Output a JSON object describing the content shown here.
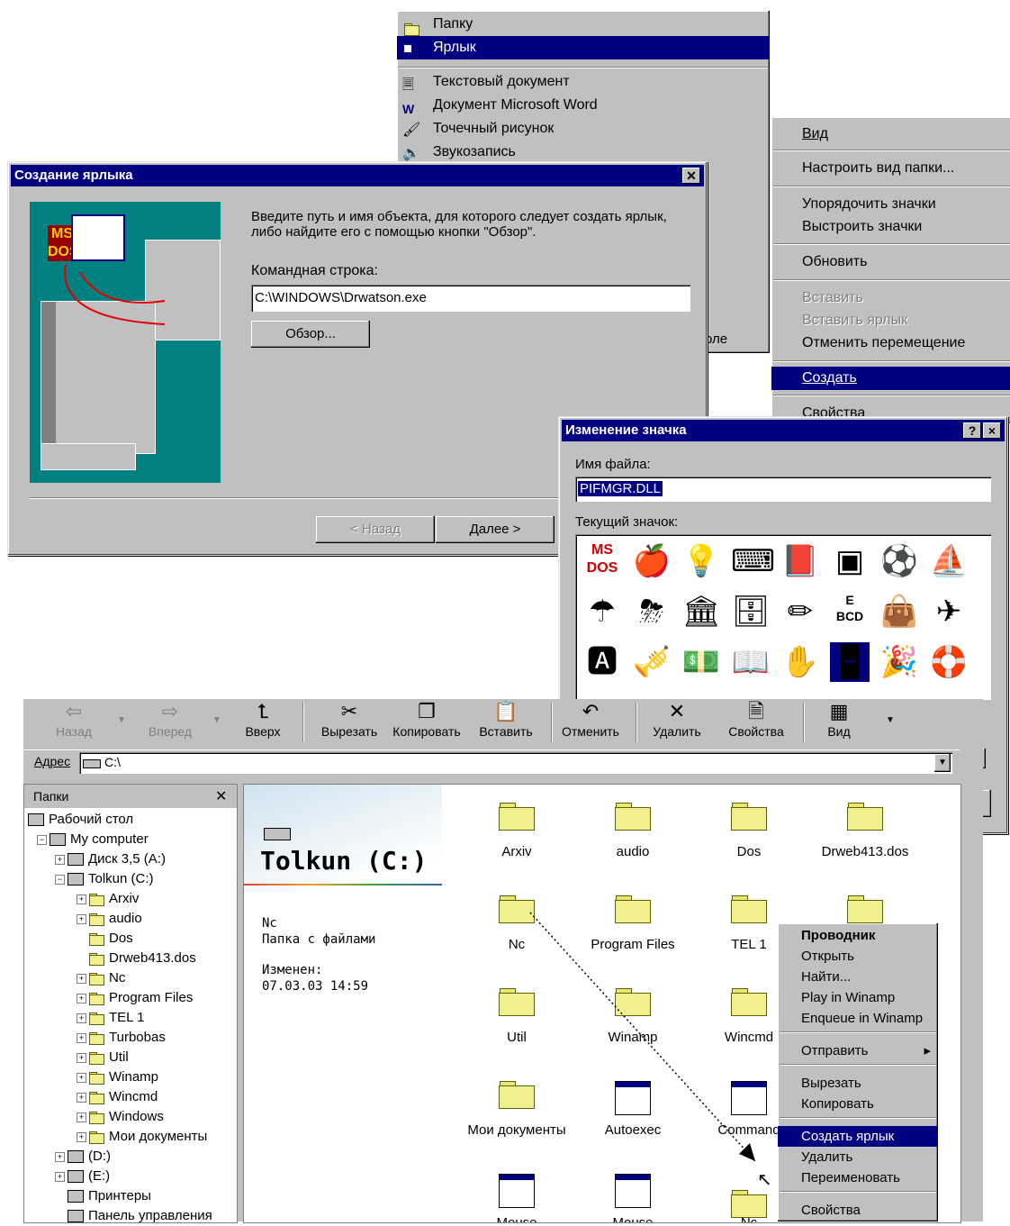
{
  "new_submenu": {
    "items": [
      {
        "label": "Папку",
        "icon": "folder-icon"
      },
      {
        "label": "Ярлык",
        "icon": "shortcut-icon",
        "selected": true
      },
      {
        "label": "Текстовый документ",
        "icon": "text-document-icon"
      },
      {
        "label": "Документ Microsoft Word",
        "icon": "word-document-icon"
      },
      {
        "label": "Точечный рисунок",
        "icon": "bitmap-icon"
      },
      {
        "label": "Звукозапись",
        "icon": "sound-icon"
      }
    ],
    "partial_text": "оле"
  },
  "desktop_menu": {
    "items": [
      {
        "label": "Вид",
        "submenu": true
      },
      {
        "label": "Настроить вид папки..."
      },
      {
        "label": "Упорядочить значки",
        "submenu": true
      },
      {
        "label": "Выстроить значки"
      },
      {
        "label": "Обновить"
      },
      {
        "label": "Вставить",
        "disabled": true
      },
      {
        "label": "Вставить ярлык",
        "disabled": true
      },
      {
        "label": "Отменить перемещение"
      },
      {
        "label": "Создать",
        "selected": true,
        "submenu": true
      },
      {
        "label": "Свойства"
      }
    ]
  },
  "create_shortcut_dialog": {
    "title": "Создание ярлыка",
    "instructions": "Введите путь и имя объекта, для которого следует создать ярлык, либо найдите его с помощью кнопки \"Обзор\".",
    "command_line_label": "Командная строка:",
    "command_line_value": "C:\\WINDOWS\\Drwatson.exe",
    "browse_label": "Обзор...",
    "back_label": "< Назад",
    "next_label": "Далее >"
  },
  "change_icon_dialog": {
    "title": "Изменение значка",
    "help_label": "?",
    "close_label": "×",
    "filename_label": "Имя файла:",
    "filename_value": "PIFMGR.DLL",
    "current_icon_label": "Текущий значок:",
    "icons": [
      "ms-dos-icon",
      "apple-icon",
      "lightbulb-icon",
      "keyboard-icon",
      "book-icon",
      "window-icon",
      "soccer-ball-icon",
      "ship-icon",
      "umbrella-icon",
      "storm-cloud-icon",
      "column-icon",
      "cabinet-icon",
      "pencil-icon",
      "eye-chart-icon",
      "bag-icon",
      "airplane-icon",
      "blocks-icon",
      "tuba-icon",
      "money-icon",
      "open-book-icon",
      "hand-icon",
      "dominoes-icon",
      "party-hat-icon",
      "lifebuoy-icon"
    ]
  },
  "explorer": {
    "toolbar": [
      {
        "label": "Назад",
        "glyph": "⇦",
        "disabled": true
      },
      {
        "label": "Вперед",
        "glyph": "⇨",
        "disabled": true
      },
      {
        "label": "Вверх",
        "glyph": "⮤"
      },
      {
        "label": "Вырезать",
        "glyph": "✂"
      },
      {
        "label": "Копировать",
        "glyph": "❐"
      },
      {
        "label": "Вставить",
        "glyph": "📋"
      },
      {
        "label": "Отменить",
        "glyph": "↶"
      },
      {
        "label": "Удалить",
        "glyph": "✕"
      },
      {
        "label": "Свойства",
        "glyph": "🗎"
      },
      {
        "label": "Вид",
        "glyph": "▦"
      }
    ],
    "address_label": "Адрес",
    "address_value": "C:\\",
    "folders_pane_title": "Папки",
    "tree": [
      {
        "label": "Рабочий стол",
        "level": 0,
        "icon": "desktop-icon"
      },
      {
        "label": "My computer",
        "level": 1,
        "icon": "computer-icon",
        "expander": "−"
      },
      {
        "label": "Диск 3,5 (A:)",
        "level": 2,
        "icon": "floppy-icon",
        "expander": "+"
      },
      {
        "label": "Tolkun (C:)",
        "level": 2,
        "icon": "drive-icon",
        "expander": "−"
      },
      {
        "label": "Arxiv",
        "level": 3,
        "icon": "folder-icon",
        "expander": "+"
      },
      {
        "label": "audio",
        "level": 3,
        "icon": "folder-icon",
        "expander": "+"
      },
      {
        "label": "Dos",
        "level": 3,
        "icon": "folder-icon"
      },
      {
        "label": "Drweb413.dos",
        "level": 3,
        "icon": "folder-icon"
      },
      {
        "label": "Nc",
        "level": 3,
        "icon": "folder-icon",
        "expander": "+"
      },
      {
        "label": "Program Files",
        "level": 3,
        "icon": "folder-icon",
        "expander": "+"
      },
      {
        "label": "TEL 1",
        "level": 3,
        "icon": "folder-icon",
        "expander": "+"
      },
      {
        "label": "Turbobas",
        "level": 3,
        "icon": "folder-icon",
        "expander": "+"
      },
      {
        "label": "Util",
        "level": 3,
        "icon": "folder-icon",
        "expander": "+"
      },
      {
        "label": "Winamp",
        "level": 3,
        "icon": "folder-icon",
        "expander": "+"
      },
      {
        "label": "Wincmd",
        "level": 3,
        "icon": "folder-icon",
        "expander": "+"
      },
      {
        "label": "Windows",
        "level": 3,
        "icon": "folder-icon",
        "expander": "+"
      },
      {
        "label": "Мои документы",
        "level": 3,
        "icon": "my-documents-icon",
        "expander": "+"
      },
      {
        "label": "(D:)",
        "level": 2,
        "icon": "drive-icon",
        "expander": "+"
      },
      {
        "label": "(E:)",
        "level": 2,
        "icon": "cd-drive-icon",
        "expander": "+"
      },
      {
        "label": "Принтеры",
        "level": 2,
        "icon": "printer-icon"
      },
      {
        "label": "Панель управления",
        "level": 2,
        "icon": "control-panel-icon"
      }
    ],
    "drive_title": "Tolkun (C:)",
    "selected_name": "Nc",
    "selected_type": "Папка с файлами",
    "modified_label": "Изменен:",
    "modified_value": "07.03.03 14:59",
    "files": [
      {
        "label": "Arxiv",
        "icon": "folder-icon"
      },
      {
        "label": "audio",
        "icon": "folder-icon"
      },
      {
        "label": "Dos",
        "icon": "folder-icon"
      },
      {
        "label": "Drweb413.dos",
        "icon": "folder-icon"
      },
      {
        "label": "Nc",
        "icon": "folder-icon"
      },
      {
        "label": "Program Files",
        "icon": "folder-icon"
      },
      {
        "label": "TEL 1",
        "icon": "folder-icon"
      },
      {
        "label": "",
        "icon": "folder-icon"
      },
      {
        "label": "Util",
        "icon": "folder-icon"
      },
      {
        "label": "Winamp",
        "icon": "folder-icon"
      },
      {
        "label": "Wincmd",
        "icon": "folder-icon"
      },
      {
        "label": "Мои документы",
        "icon": "my-documents-icon"
      },
      {
        "label": "Autoexec",
        "icon": "batch-file-icon"
      },
      {
        "label": "Command",
        "icon": "program-icon"
      },
      {
        "label": "Mouse",
        "icon": "program-icon"
      },
      {
        "label": "Mouse",
        "icon": "text-file-icon"
      },
      {
        "label": "Nc",
        "icon": "folder-icon"
      }
    ],
    "context_menu": [
      {
        "label": "Проводник",
        "bold": true
      },
      {
        "label": "Открыть"
      },
      {
        "label": "Найти..."
      },
      {
        "label": "Play in Winamp"
      },
      {
        "label": "Enqueue in Winamp"
      },
      {
        "label": "Отправить",
        "submenu": true
      },
      {
        "label": "Вырезать"
      },
      {
        "label": "Копировать"
      },
      {
        "label": "Создать ярлык",
        "selected": true
      },
      {
        "label": "Удалить"
      },
      {
        "label": "Переименовать"
      },
      {
        "label": "Свойства"
      }
    ]
  },
  "colors": {
    "title_bar": "#000080",
    "face": "#c0c0c0",
    "teal": "#008080",
    "folder": "#f0f090"
  }
}
